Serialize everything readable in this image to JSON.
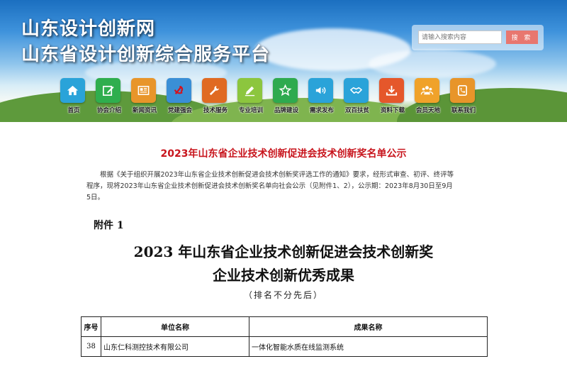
{
  "site": {
    "name": "山东设计创新网",
    "subtitle": "山东省设计创新综合服务平台"
  },
  "search": {
    "placeholder": "请输入搜索内容",
    "button_label": "搜 索"
  },
  "nav": {
    "items": [
      {
        "label": "首页",
        "icon": "home-icon",
        "color": "#2aa3d9"
      },
      {
        "label": "协会介绍",
        "icon": "edit-icon",
        "color": "#2fae4e"
      },
      {
        "label": "新闻资讯",
        "icon": "newspaper-icon",
        "color": "#e8952a"
      },
      {
        "label": "党建强会",
        "icon": "party-emblem-icon",
        "color": "#3a8fd6"
      },
      {
        "label": "技术服务",
        "icon": "wrench-icon",
        "color": "#e06a22"
      },
      {
        "label": "专业培训",
        "icon": "pencil-icon",
        "color": "#8cc63e"
      },
      {
        "label": "品牌建设",
        "icon": "star-icon",
        "color": "#2eaa4f"
      },
      {
        "label": "需求发布",
        "icon": "speaker-icon",
        "color": "#2aa3d9"
      },
      {
        "label": "双百扶贫",
        "icon": "handshake-icon",
        "color": "#2aa3d9"
      },
      {
        "label": "资料下载",
        "icon": "download-icon",
        "color": "#e5572b"
      },
      {
        "label": "会员天地",
        "icon": "members-icon",
        "color": "#f0a22a"
      },
      {
        "label": "联系我们",
        "icon": "phone-icon",
        "color": "#e8952a"
      }
    ]
  },
  "article": {
    "title": "2023年山东省企业技术创新促进会技术创新奖名单公示",
    "body": "根据《关于组织开展2023年山东省企业技术创新促进会技术创新奖评选工作的通知》要求，经形式审查、初评、终评等程序，现将2023年山东省企业技术创新促进会技术创新奖名单向社会公示（见附件1、2），公示期：2023年8月30日至9月5日。"
  },
  "attachment": {
    "label": "附件 1",
    "title_line1": "2023 年山东省企业技术创新促进会技术创新奖",
    "title_line2": "企业技术创新优秀成果",
    "note": "（排名不分先后）"
  },
  "table": {
    "headers": [
      "序号",
      "单位名称",
      "成果名称"
    ],
    "rows": [
      [
        "38",
        "山东仁科测控技术有限公司",
        "一体化智能水质在线监测系统"
      ]
    ]
  },
  "colors": {
    "title_red": "#c8151d",
    "search_button": "#e8776f"
  }
}
